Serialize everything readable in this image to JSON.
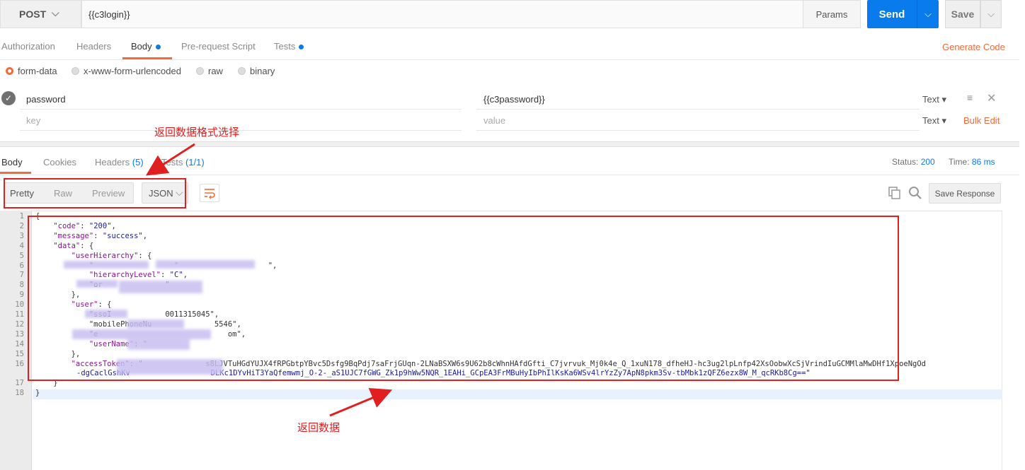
{
  "request": {
    "method": "POST",
    "url": "{{c3login}}",
    "params_label": "Params",
    "send_label": "Send",
    "save_label": "Save"
  },
  "req_tabs": [
    {
      "label": "Authorization",
      "dot": false
    },
    {
      "label": "Headers",
      "dot": false
    },
    {
      "label": "Body",
      "dot": true,
      "active": true
    },
    {
      "label": "Pre-request Script",
      "dot": false
    },
    {
      "label": "Tests",
      "dot": true
    }
  ],
  "generate_code": "Generate Code",
  "body_modes": [
    {
      "label": "form-data",
      "selected": true
    },
    {
      "label": "x-www-form-urlencoded",
      "selected": false
    },
    {
      "label": "raw",
      "selected": false
    },
    {
      "label": "binary",
      "selected": false
    }
  ],
  "form_rows": [
    {
      "key": "password",
      "value": "{{c3password}}",
      "type": "Text"
    },
    {
      "key": "key",
      "value": "value",
      "type": "Text",
      "placeholder": true
    }
  ],
  "bulk_edit": "Bulk Edit",
  "response": {
    "tabs": [
      {
        "label": "Body",
        "count": "",
        "active": true
      },
      {
        "label": "Cookies",
        "count": ""
      },
      {
        "label": "Headers",
        "count": "(5)"
      },
      {
        "label": "Tests",
        "count": "(1/1)"
      }
    ],
    "status_label": "Status:",
    "status_value": "200",
    "time_label": "Time:",
    "time_value": "86 ms",
    "formats": [
      "Pretty",
      "Raw",
      "Preview"
    ],
    "language": "JSON",
    "save_response": "Save Response"
  },
  "code_lines": [
    "{",
    "    \"code\": \"200\",",
    "    \"message\": \"success\",",
    "    \"data\": {",
    "        \"userHierarchy\": {",
    "            \"                  \"                    \",",
    "            \"hierarchyLevel\": \"C\",",
    "            \"or              \"                ",
    "        },",
    "        \"user\": {",
    "            \"ssoI            0011315045\",",
    "            \"mobilePhoneNu              5546\",",
    "            \"e                             om\",",
    "            \"userName\": \"        ",
    "        },",
    "        \"accessToken\": \"              s8LJVTuHGdYUJX4fRPGbtpYBvc5Dsfg9BqPdj7saFrjGUqn-2LNaBSXW6s9U62b8cWhnHAfdGfti_C7jvrvuk_Mj0k4e_Q_1xuN178_dfheHJ-hc3ug2lpLnfp42XsOobwXcSjVrindIuGCMMlaMwDHf1XpoeNgOd",
    "    }",
    "}"
  ],
  "token_wrap": "-dgCaclGshKv                  DLKc1DYvHiT3YaQfemwmj_O-2-_aS1UJC7fGWG_Zk1p9hWw5NQR_1EAHi_GCpEA3FrMBuHyIbPhIlKsKa6WSv4lrYzZy7ApN8pkm3Sv-tbMbk1zQFZ6ezx8W_M_qcRKb8Cg==\"",
  "annotations": {
    "format_note": "返回数据格式选择",
    "data_note": "返回数据"
  }
}
